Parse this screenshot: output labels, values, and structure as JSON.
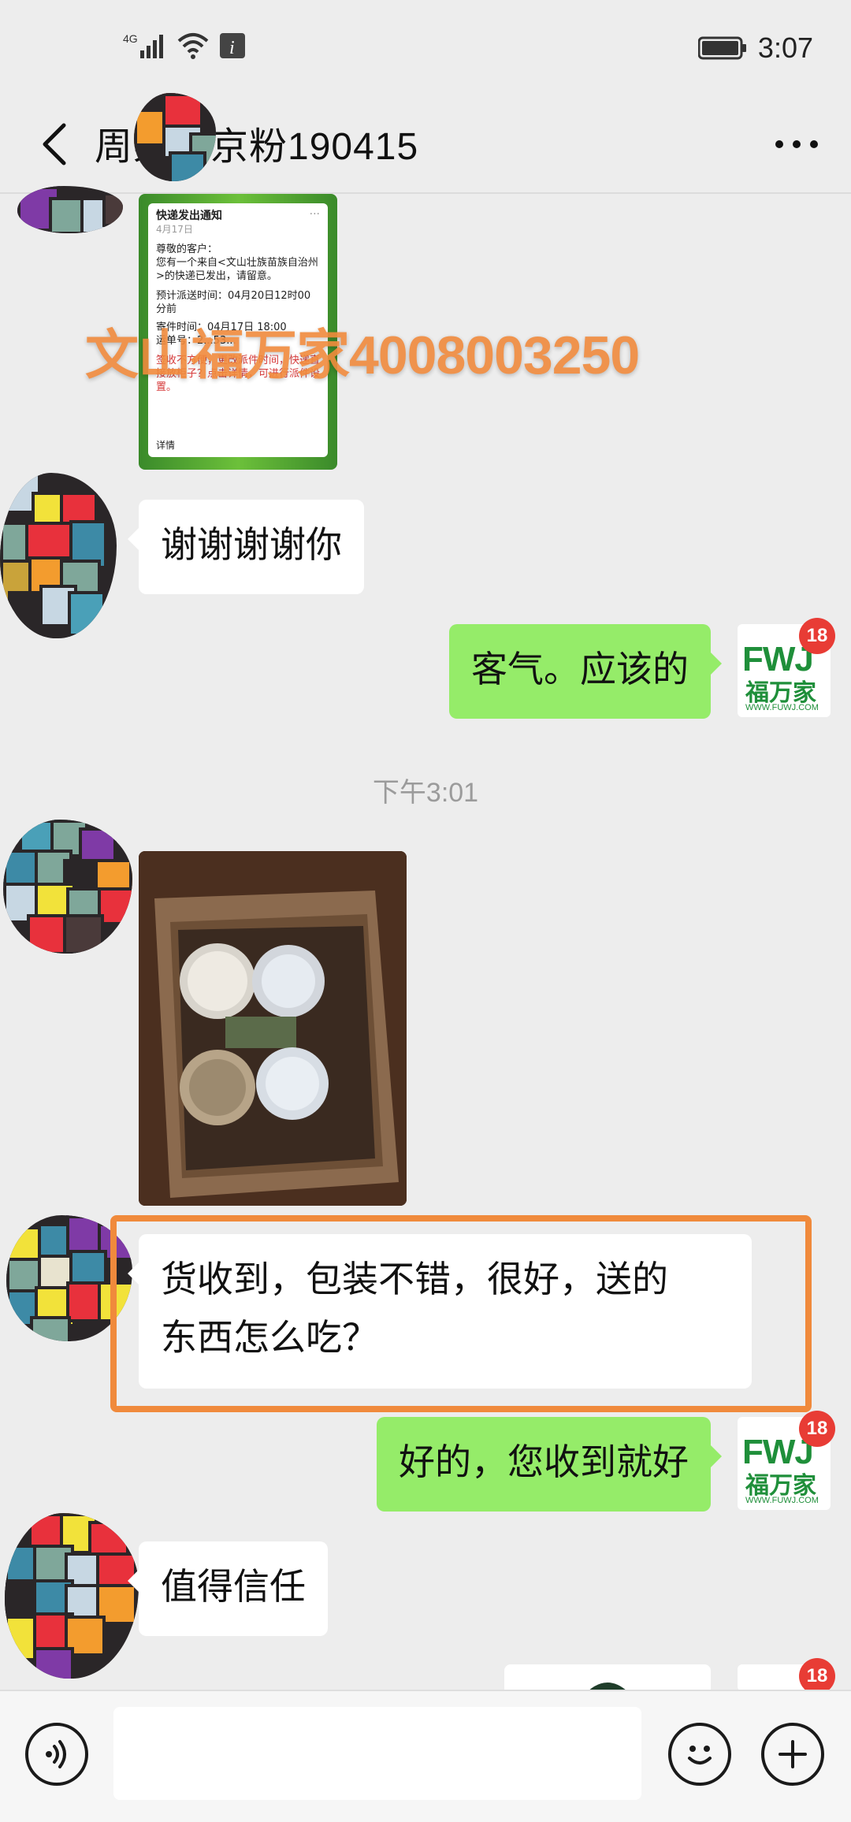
{
  "status_bar": {
    "network": "4G",
    "time": "3:07"
  },
  "header": {
    "title": "周某北京粉190415",
    "back_icon": "chevron-left-icon",
    "more_icon": "more-dots-icon"
  },
  "messages": [
    {
      "type": "card",
      "direction": "in",
      "card": {
        "title": "快递发出通知",
        "date": "4月17日",
        "greeting": "尊敬的客户：",
        "body": "您有一个来自<文山壮族苗族自治州>的快递已发出，请留意。",
        "eta": "预计派送时间：04月20日12时00分前",
        "sender_line": "寄件时间：04月17日 18:00",
        "number_line": "运单号：2...53...",
        "warning": "签收不方便，更改派件时间，快递直接放柜子？点击详情，可进行派件设置。",
        "detail_label": "详情"
      }
    },
    {
      "type": "text",
      "direction": "in",
      "text": "谢谢谢谢你"
    },
    {
      "type": "text",
      "direction": "out",
      "text": "客气。应该的"
    },
    {
      "type": "time",
      "text": "下午3:01"
    },
    {
      "type": "image",
      "direction": "in"
    },
    {
      "type": "text",
      "direction": "in",
      "lines": [
        "货收到，包装不错，很好，送的",
        "东西怎么吃？"
      ],
      "highlighted": true
    },
    {
      "type": "text",
      "direction": "out",
      "text": "好的，您收到就好"
    },
    {
      "type": "text",
      "direction": "in",
      "text": "值得信任"
    }
  ],
  "watermark": "文山福万家4008003250",
  "self_avatar": {
    "logo_letters": "FWJ",
    "logo_cn": "福万家",
    "logo_url": "WWW.FUWJ.COM",
    "badge": "18"
  },
  "input_bar": {
    "voice_icon": "voice-icon",
    "emoji_icon": "emoji-icon",
    "plus_icon": "plus-icon"
  },
  "colors": {
    "bg": "#ededed",
    "out_bubble": "#95ec69",
    "in_bubble": "#ffffff",
    "highlight": "#f08a3c",
    "watermark": "#f08a3c"
  }
}
